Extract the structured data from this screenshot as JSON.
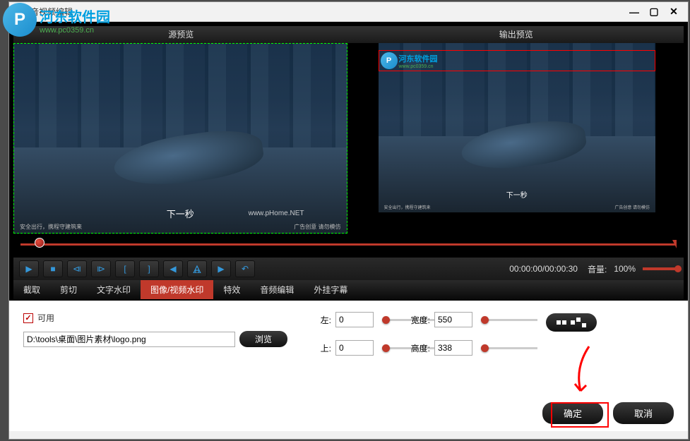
{
  "titlebar": {
    "title": "音视频编辑"
  },
  "watermark": {
    "logo_text": "河东软件园",
    "logo_url": "www.pc0359.cn",
    "logo_symbol": "P"
  },
  "preview": {
    "source_header": "源预览",
    "output_header": "输出预览",
    "subtitle": "下一秒",
    "footer_left": "安全出行，携程守建筑来",
    "footer_right": "广告创意 请勿模仿",
    "footer_left_sm": "安全出行，携程守建筑来",
    "footer_right_sm": "广告创意 请勿模仿",
    "phome": "www.pHome.NET"
  },
  "controls": {
    "time": "00:00:00/00:00:30",
    "volume_label": "音量:",
    "volume_value": "100%"
  },
  "tabs": [
    "截取",
    "剪切",
    "文字水印",
    "图像/视频水印",
    "特效",
    "音频编辑",
    "外挂字幕"
  ],
  "active_tab_index": 3,
  "panel": {
    "enable_label": "可用",
    "enable_checked": true,
    "path_value": "D:\\tools\\桌面\\图片素材\\logo.png",
    "browse_label": "浏览",
    "left_label": "左:",
    "left_value": "0",
    "top_label": "上:",
    "top_value": "0",
    "width_label": "宽度:",
    "width_value": "550",
    "height_label": "高度:",
    "height_value": "338"
  },
  "footer": {
    "confirm": "确定",
    "cancel": "取消"
  }
}
